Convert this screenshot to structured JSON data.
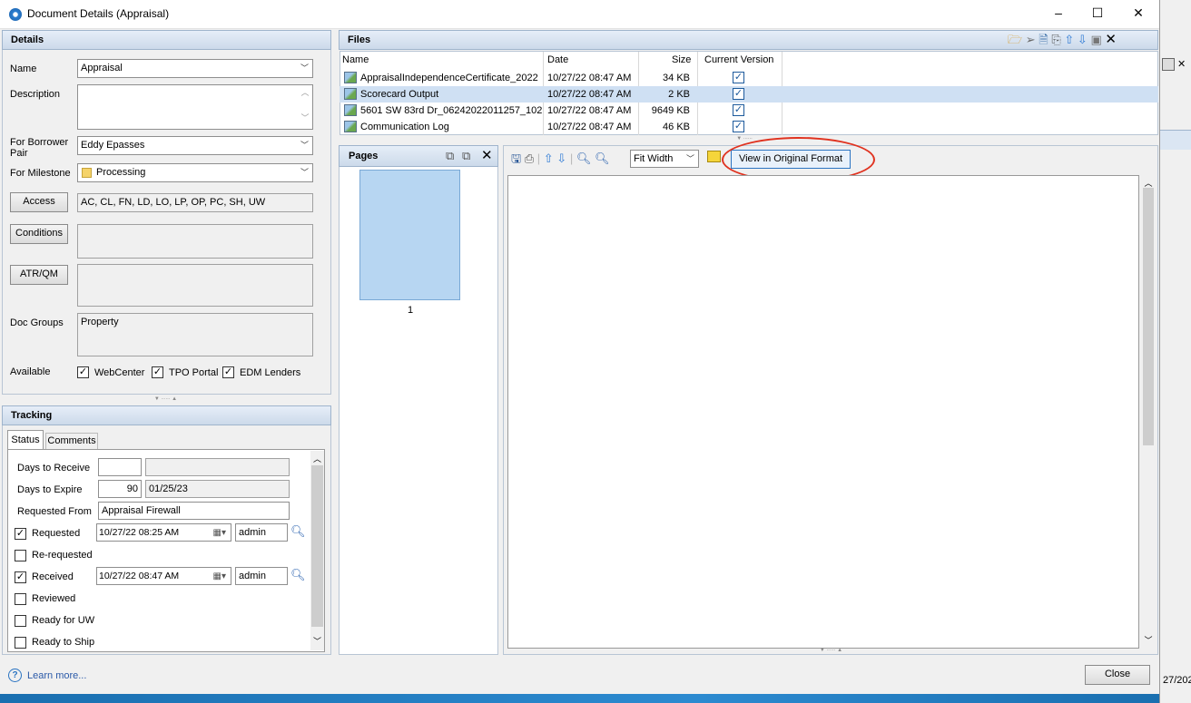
{
  "window": {
    "title": "Document Details (Appraisal)",
    "minimize": "–",
    "maximize": "☐",
    "close": "✕"
  },
  "details": {
    "header": "Details",
    "name_label": "Name",
    "name_value": "Appraisal",
    "description_label": "Description",
    "description_value": "",
    "borrower_label": "For Borrower Pair",
    "borrower_value": "Eddy Epasses",
    "milestone_label": "For Milestone",
    "milestone_value": "Processing",
    "access_button": "Access",
    "access_value": "AC, CL, FN, LD, LO, LP, OP, PC, SH, UW",
    "conditions_button": "Conditions",
    "conditions_value": "",
    "atr_button": "ATR/QM",
    "atr_value": "",
    "docgroups_label": "Doc Groups",
    "docgroups_value": "Property",
    "available_label": "Available",
    "available_options": [
      {
        "label": "WebCenter",
        "checked": true
      },
      {
        "label": "TPO Portal",
        "checked": true
      },
      {
        "label": "EDM Lenders",
        "checked": true
      }
    ]
  },
  "tracking": {
    "header": "Tracking",
    "tabs": [
      "Status",
      "Comments"
    ],
    "active_tab": "Status",
    "days_to_receive_label": "Days to Receive",
    "days_to_receive_value": "",
    "days_to_receive_date": "",
    "days_to_expire_label": "Days to Expire",
    "days_to_expire_value": "90",
    "days_to_expire_date": "01/25/23",
    "requested_from_label": "Requested From",
    "requested_from_value": "Appraisal Firewall",
    "rows": [
      {
        "label": "Requested",
        "checked": true,
        "date": "10/27/22 08:25 AM",
        "user": "admin"
      },
      {
        "label": "Re-requested",
        "checked": false
      },
      {
        "label": "Received",
        "checked": true,
        "date": "10/27/22 08:47 AM",
        "user": "admin"
      },
      {
        "label": "Reviewed",
        "checked": false
      },
      {
        "label": "Ready for UW",
        "checked": false
      },
      {
        "label": "Ready to Ship",
        "checked": false
      }
    ]
  },
  "files": {
    "header": "Files",
    "columns": [
      "Name",
      "Date",
      "Size",
      "Current Version"
    ],
    "rows": [
      {
        "name": "AppraisalIndependenceCertificate_2022",
        "date": "10/27/22 08:47 AM",
        "size": "34 KB",
        "current": true
      },
      {
        "name": "Scorecard Output",
        "date": "10/27/22 08:47 AM",
        "size": "2 KB",
        "current": true
      },
      {
        "name": "5601 SW 83rd Dr_06242022011257_102",
        "date": "10/27/22 08:47 AM",
        "size": "9649 KB",
        "current": true
      },
      {
        "name": "Communication Log",
        "date": "10/27/22 08:47 AM",
        "size": "46 KB",
        "current": true
      }
    ],
    "selected_row": 1
  },
  "pages": {
    "header": "Pages",
    "page_number": "1"
  },
  "viewer": {
    "zoom": "Fit Width",
    "original_format_button": "View in Original Format",
    "highlight_color": "#e0321f"
  },
  "footer": {
    "learn_more": "Learn more...",
    "close_button": "Close",
    "behind_text": "27/202"
  },
  "colors": {
    "accent": "#1d5a9c",
    "header_bg": "#dde7f3",
    "selected_row": "#cfe0f3"
  }
}
